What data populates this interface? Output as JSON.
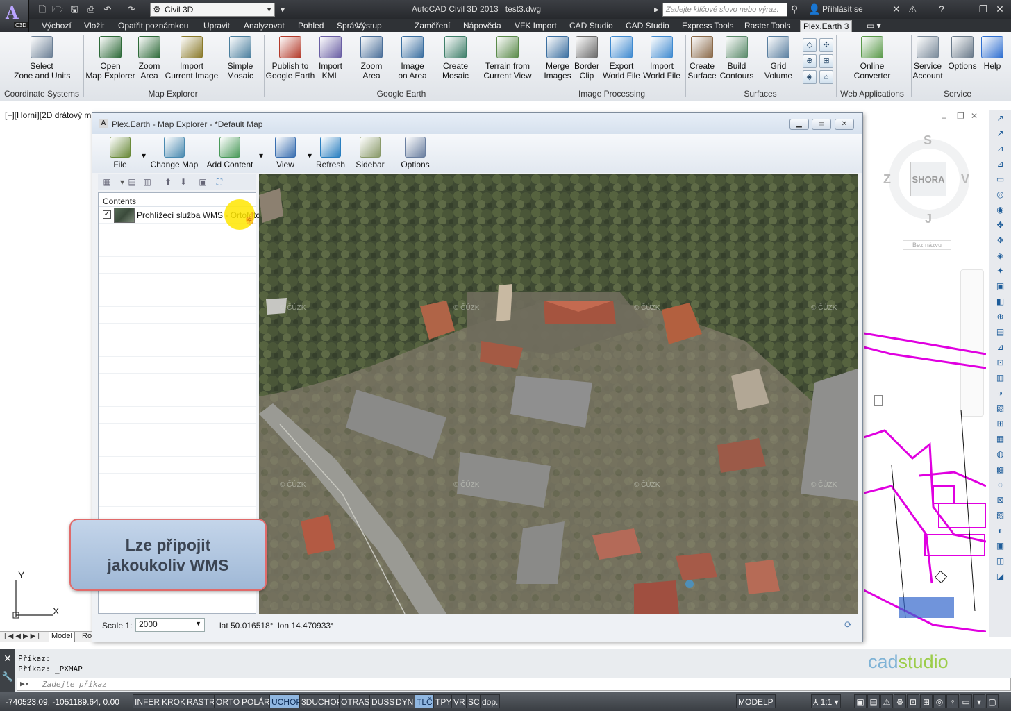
{
  "app": {
    "title": "AutoCAD Civil 3D 2013",
    "document": "test3.dwg",
    "workspace": "Civil 3D",
    "search_placeholder": "Zadejte klíčové slovo nebo výraz.",
    "signin": "Přihlásit se",
    "badge": "C3D"
  },
  "tabs": [
    "Výchozí",
    "Vložit",
    "Opatřit poznámkou",
    "Upravit",
    "Analyzovat",
    "Pohled",
    "Správa",
    "Výstup",
    "Zaměření",
    "Nápověda",
    "VFK Import",
    "CAD Studio",
    "CAD Studio",
    "Express Tools",
    "Raster Tools",
    "Plex.Earth 3"
  ],
  "active_tab": "Plex.Earth 3",
  "ribbon": {
    "buttons": [
      {
        "label": "Select\nZone and Units"
      },
      {
        "label": "Open\nMap Explorer"
      },
      {
        "label": "Zoom\nArea"
      },
      {
        "label": "Import\nCurrent Image"
      },
      {
        "label": "Simple\nMosaic"
      },
      {
        "label": "Publish to\nGoogle Earth"
      },
      {
        "label": "Import\nKML"
      },
      {
        "label": "Zoom\nArea"
      },
      {
        "label": "Image\non Area"
      },
      {
        "label": "Create\nMosaic"
      },
      {
        "label": "Terrain from\nCurrent View"
      },
      {
        "label": "Merge\nImages"
      },
      {
        "label": "Border\nClip"
      },
      {
        "label": "Export\nWorld File"
      },
      {
        "label": "Import\nWorld File"
      },
      {
        "label": "Create\nSurface"
      },
      {
        "label": "Build\nContours"
      },
      {
        "label": "Grid\nVolume"
      },
      {
        "label": "Online\nConverter"
      },
      {
        "label": "Service\nAccount"
      },
      {
        "label": "Options"
      },
      {
        "label": "Help"
      }
    ],
    "groups": [
      "Coordinate Systems",
      "Map Explorer",
      "Google Earth",
      "Image Processing",
      "Surfaces",
      "Web Applications",
      "Service"
    ]
  },
  "viewport": {
    "label": "[−][Horní][2D drátový m",
    "viewcube": {
      "north": "S",
      "west": "Z",
      "east": "V",
      "south": "J",
      "face": "SHORA",
      "ucs": "Bez názvu"
    },
    "ucs_x": "X",
    "ucs_y": "Y"
  },
  "map_explorer": {
    "title": "Plex.Earth - Map Explorer - *Default Map",
    "window_icon": "A",
    "tools": [
      {
        "label": "File"
      },
      {
        "label": "Change Map"
      },
      {
        "label": "Add Content"
      },
      {
        "label": "View"
      },
      {
        "label": "Refresh"
      },
      {
        "label": "Sidebar"
      },
      {
        "label": "Options"
      }
    ],
    "contents_header": "Contents",
    "layer": {
      "name": "Prohlížecí služba WMS - Ortofoto",
      "checked": true,
      "check_mark": "✓"
    },
    "scale_label": "Scale 1:",
    "scale_value": "2000",
    "lat": "lat 50.016518°",
    "lon": "lon 14.470933°",
    "watermark": "© ČÚZK"
  },
  "callout": {
    "line1": "Lze připojit",
    "line2": "jakoukoliv WMS"
  },
  "model_tabs": {
    "model": "Model",
    "layout": "Ro"
  },
  "command": {
    "line1": "Příkaz:",
    "line2": "Příkaz: _PXMAP",
    "placeholder": "Zadejte příkaz"
  },
  "status": {
    "coords": "-740523.09, -1051189.64, 0.00",
    "toggles": [
      {
        "label": "INFER",
        "on": false
      },
      {
        "label": "KROK",
        "on": false
      },
      {
        "label": "RASTR",
        "on": false
      },
      {
        "label": "ORTO",
        "on": false
      },
      {
        "label": "POLÁR",
        "on": false
      },
      {
        "label": "UCHOP",
        "on": true
      },
      {
        "label": "3DUCHOP",
        "on": false
      },
      {
        "label": "OTRAS",
        "on": false
      },
      {
        "label": "DUSS",
        "on": false
      },
      {
        "label": "DYN",
        "on": false
      },
      {
        "label": "TLČ",
        "on": true
      },
      {
        "label": "TPY",
        "on": false
      },
      {
        "label": "VR",
        "on": false
      },
      {
        "label": "SC",
        "on": false
      },
      {
        "label": "dop.",
        "on": false
      }
    ],
    "modelp": "MODELP",
    "scale": "1:1"
  },
  "watermark_logo": {
    "part1": "cad",
    "part2": "studio"
  },
  "colors": {
    "accent": "#8fb6e0",
    "plan_magenta": "#e000e0",
    "callout_border": "#e06a6a"
  }
}
